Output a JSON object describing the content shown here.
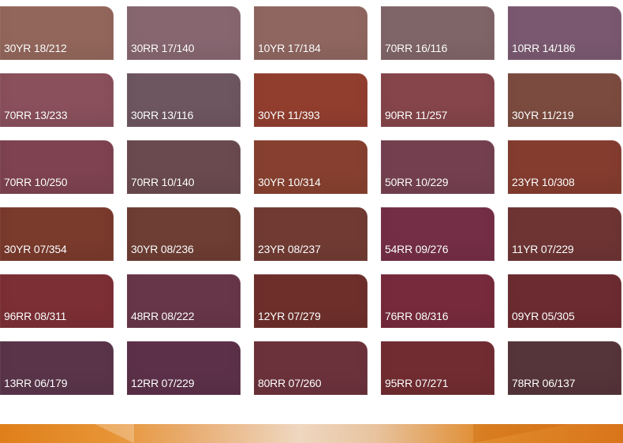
{
  "swatches": [
    {
      "code": "30YR 18/212",
      "color": "#93665b"
    },
    {
      "code": "30RR 17/140",
      "color": "#876670"
    },
    {
      "code": "10YR 17/184",
      "color": "#906660"
    },
    {
      "code": "70RR 16/116",
      "color": "#806568"
    },
    {
      "code": "10RR 14/186",
      "color": "#7a5970"
    },
    {
      "code": "70RR 13/233",
      "color": "#8a505c"
    },
    {
      "code": "30RR 13/116",
      "color": "#6e5660"
    },
    {
      "code": "30YR 11/393",
      "color": "#923e2f"
    },
    {
      "code": "90RR 11/257",
      "color": "#85454a"
    },
    {
      "code": "30YR 11/219",
      "color": "#7c4b3f"
    },
    {
      "code": "70RR 10/250",
      "color": "#7e4250"
    },
    {
      "code": "70RR 10/140",
      "color": "#6a4a4e"
    },
    {
      "code": "30YR 10/314",
      "color": "#87402f"
    },
    {
      "code": "50RR 10/229",
      "color": "#74404f"
    },
    {
      "code": "23YR 10/308",
      "color": "#843c2f"
    },
    {
      "code": "30YR 07/354",
      "color": "#7a3a2c"
    },
    {
      "code": "30YR 08/236",
      "color": "#6e3d33"
    },
    {
      "code": "23YR 08/237",
      "color": "#713b33"
    },
    {
      "code": "54RR 09/276",
      "color": "#742e45"
    },
    {
      "code": "11YR 07/229",
      "color": "#6e3434"
    },
    {
      "code": "96RR 08/311",
      "color": "#7c2f35"
    },
    {
      "code": "48RR 08/222",
      "color": "#683649"
    },
    {
      "code": "12YR 07/279",
      "color": "#6e2f2b"
    },
    {
      "code": "76RR 08/316",
      "color": "#772a3b"
    },
    {
      "code": "09YR 05/305",
      "color": "#6c2b30"
    },
    {
      "code": "13RR 06/179",
      "color": "#5a3549"
    },
    {
      "code": "12RR 07/229",
      "color": "#5c3049"
    },
    {
      "code": "80RR 07/260",
      "color": "#6c323c"
    },
    {
      "code": "95RR 07/271",
      "color": "#712c31"
    },
    {
      "code": "78RR 06/137",
      "color": "#55343a"
    }
  ],
  "banner": {
    "accent": "#e07f1a"
  }
}
